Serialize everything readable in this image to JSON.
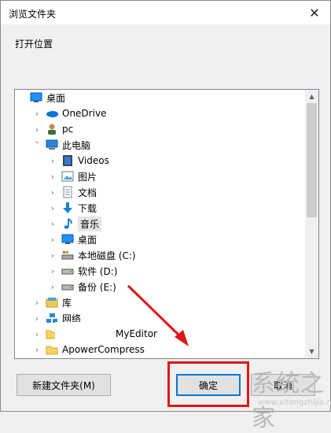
{
  "window": {
    "title": "浏览文件夹",
    "close_glyph": "✕"
  },
  "prompt": "打开位置",
  "tree": [
    {
      "label": "桌面",
      "icon": "desktop-icon",
      "chevron": ""
    },
    {
      "label": "OneDrive",
      "icon": "onedrive-icon",
      "chevron": ">"
    },
    {
      "label": "pc",
      "icon": "user-icon",
      "chevron": ">"
    },
    {
      "label": "此电脑",
      "icon": "computer-icon",
      "chevron": "v"
    },
    {
      "label": "Videos",
      "icon": "videos-icon",
      "chevron": ">"
    },
    {
      "label": "图片",
      "icon": "pictures-icon",
      "chevron": ">"
    },
    {
      "label": "文档",
      "icon": "documents-icon",
      "chevron": ">"
    },
    {
      "label": "下载",
      "icon": "download-icon",
      "chevron": ">"
    },
    {
      "label": "音乐",
      "icon": "music-icon",
      "chevron": ">",
      "selected": true
    },
    {
      "label": "桌面",
      "icon": "desktop-icon",
      "chevron": ">"
    },
    {
      "label": "本地磁盘 (C:)",
      "icon": "drive-c-icon",
      "chevron": ">"
    },
    {
      "label": "软件 (D:)",
      "icon": "drive-icon",
      "chevron": ">"
    },
    {
      "label": "备份 (E:)",
      "icon": "drive-icon",
      "chevron": ">"
    },
    {
      "label": "库",
      "icon": "library-icon",
      "chevron": ">"
    },
    {
      "label": "网络",
      "icon": "network-icon",
      "chevron": ">"
    },
    {
      "label": "MyEditor",
      "icon": "folder-icon",
      "chevron": ">"
    },
    {
      "label": "ApowerCompress",
      "icon": "folder-icon",
      "chevron": ">"
    }
  ],
  "buttons": {
    "new_folder": "新建文件夹(M)",
    "ok": "确定",
    "cancel": "取消"
  },
  "watermark": {
    "main": "系统之家",
    "sub": "www.xitongzhijia.net"
  },
  "colors": {
    "accent": "#0078d7",
    "highlight": "#e01616"
  }
}
